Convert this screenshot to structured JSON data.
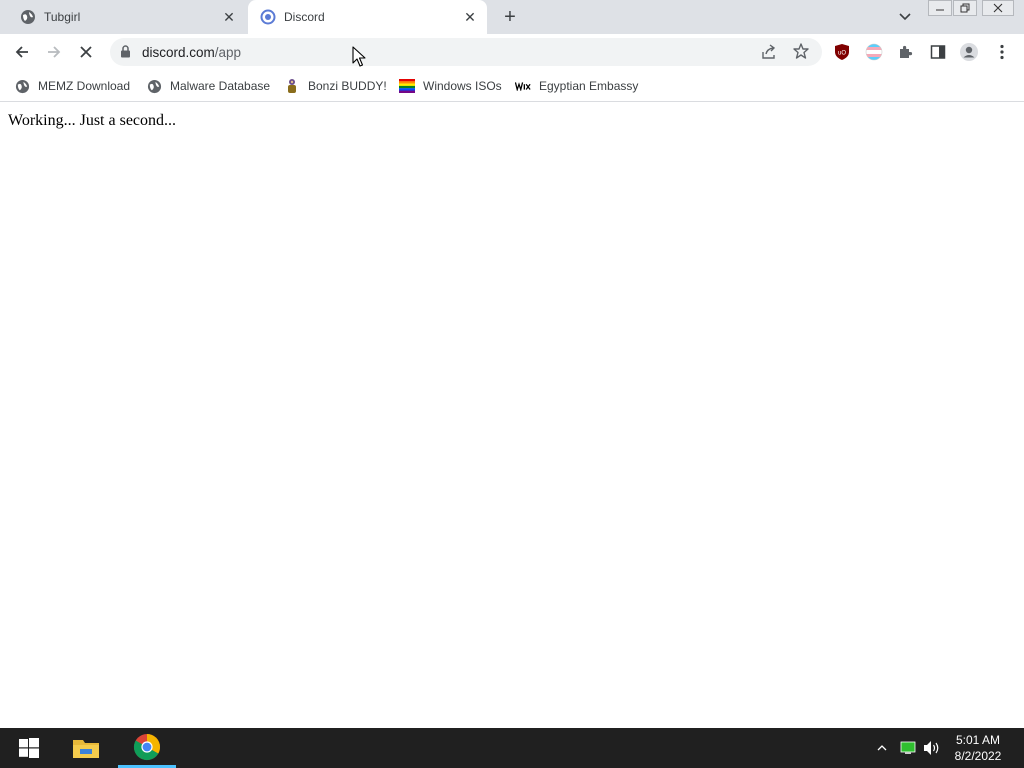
{
  "tabs": [
    {
      "title": "Tubgirl",
      "favicon": "globe-icon",
      "active": false
    },
    {
      "title": "Discord",
      "favicon": "discord-loading-icon",
      "active": true
    }
  ],
  "toolbar": {
    "url_host": "discord.com",
    "url_path": "/app"
  },
  "bookmarks": [
    {
      "label": "MEMZ Download",
      "icon": "globe-icon"
    },
    {
      "label": "Malware Database",
      "icon": "globe-icon"
    },
    {
      "label": "Bonzi BUDDY!",
      "icon": "bonzi-icon"
    },
    {
      "label": "Windows ISOs",
      "icon": "rainbow-flag-icon"
    },
    {
      "label": "Egyptian Embassy",
      "icon": "wix-icon"
    }
  ],
  "page": {
    "message": "Working... Just a second..."
  },
  "taskbar": {
    "time": "5:01 AM",
    "date": "8/2/2022",
    "accent": "#4cc2ff"
  },
  "colors": {
    "tabstrip": "#dee1e6",
    "taskbar": "#202020"
  }
}
